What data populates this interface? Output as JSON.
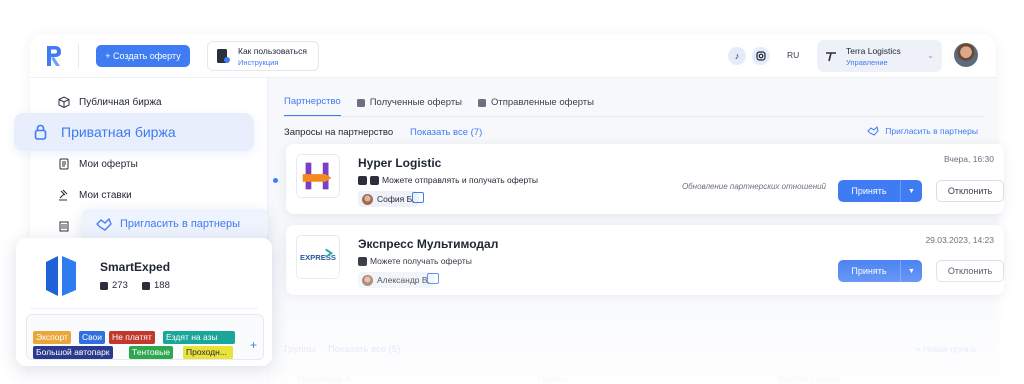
{
  "header": {
    "create_offer": "+ Создать оферту",
    "howto_title": "Как пользоваться",
    "howto_sub": "Инструкция",
    "lang": "RU",
    "company_name": "Terra Logistics",
    "company_role": "Управление",
    "icons": [
      "tiktok-icon",
      "instagram-icon",
      "document-icon",
      "chevron-down-icon"
    ]
  },
  "sidebar": {
    "items": [
      {
        "label": "Публичная биржа",
        "icon": "box-icon"
      },
      {
        "label": "Приватная биржа",
        "icon": "lock-icon"
      },
      {
        "label": "Мои оферты",
        "icon": "note-icon"
      },
      {
        "label": "Мои ставки",
        "icon": "gavel-icon"
      }
    ]
  },
  "main": {
    "tabs": [
      {
        "label": "Партнерство",
        "active": true
      },
      {
        "label": "Полученные оферты",
        "active": false
      },
      {
        "label": "Отправленные оферты",
        "active": false
      }
    ],
    "requests_title": "Запросы на партнерство",
    "show_all": "Показать все (7)",
    "invite_partners": "Пригласить в партнеры",
    "requests": [
      {
        "company": "Hyper Logistic",
        "permission": "Можете отправлять и получать оферты",
        "user": "София Б.",
        "date": "Вчера, 16:30",
        "note": "Обновление партнерских отношений",
        "accept": "Принять",
        "reject": "Отклонить"
      },
      {
        "company": "Экспресс Мультимодал",
        "permission": "Можете получать оферты",
        "user": "Александр В.",
        "date": "29.03.2023, 14:23",
        "note": "",
        "accept": "Принять",
        "reject": "Отклонить",
        "logo_text": "EXPRESS"
      }
    ],
    "groups_title": "Группы",
    "groups_show_all": "Показать все (5)",
    "new_group": "+ Новая группа",
    "group_columns": [
      "Надежные А",
      "Гессен",
      "Внутри страны"
    ]
  },
  "overlays": {
    "private_exchange": "Приватная биржа",
    "invite_partners": "Пригласить в партнеры",
    "partner_card": {
      "name": "SmartExped",
      "stat_sent": "273",
      "stat_received": "188",
      "tags": [
        {
          "label": "Экспорт",
          "color": "#e9a63a"
        },
        {
          "label": "Свои",
          "color": "#2f6fe0"
        },
        {
          "label": "Не платят",
          "color": "#c0392b"
        },
        {
          "label": "Ездят на азы",
          "color": "#1aa79a"
        },
        {
          "label": "Большой автопарк",
          "color": "#2b3a8f"
        },
        {
          "label": "Тентовые",
          "color": "#2ea84f"
        },
        {
          "label": "Проходн...",
          "color": "#e8e23a"
        }
      ],
      "add_tag": "+"
    }
  },
  "colors": {
    "accent": "#3f7bf2",
    "text": "#1f2533",
    "background": "#f6f8fb"
  }
}
